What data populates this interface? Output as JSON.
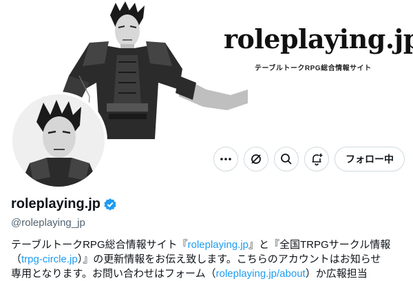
{
  "banner": {
    "site_logo": "roleplaying.jp",
    "site_tagline": "テーブルトークRPG総合情報サイト"
  },
  "actions": {
    "more_icon": "more-dots-icon",
    "retweet_icon": "slashed-repost-icon",
    "search_icon": "search-icon",
    "notify_icon": "bell-plus-icon",
    "follow_label": "フォロー中"
  },
  "profile": {
    "name": "roleplaying.jp",
    "verified_color": "#1d9bf0",
    "handle": "@roleplaying_jp"
  },
  "bio": {
    "line1_pre": "テーブルトークRPG総合情報サイト『",
    "link1": "roleplaying.jp",
    "line1_post": "』と『全国TRPGサークル情報",
    "line2_pre": "（",
    "link2": "trpg-circle.jp",
    "line2_post": "）』の更新情報をお伝え致します。こちらのアカウントはお知らせ",
    "line3_pre": "専用となります。お問い合わせはフォーム（",
    "link3": "roleplaying.jp/about",
    "line3_post": "）か広報担当"
  },
  "colors": {
    "link": "#1d9bf0",
    "text": "#0f1419",
    "muted": "#536471"
  }
}
